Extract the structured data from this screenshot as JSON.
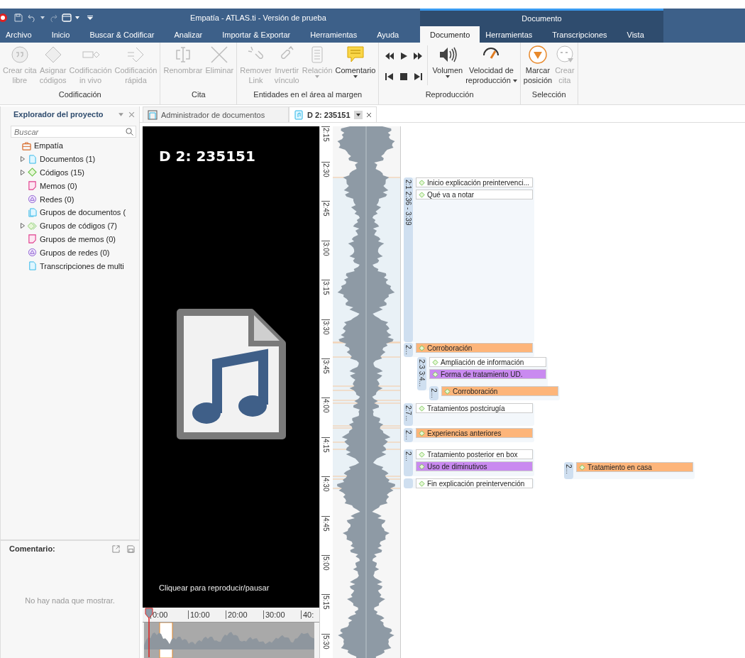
{
  "window": {
    "title": "Empatía - ATLAS.ti - Versión de prueba",
    "context_title": "Documento"
  },
  "menu_tabs": [
    {
      "label": "Archivo",
      "selected": false
    },
    {
      "label": "Inicio",
      "selected": false
    },
    {
      "label": "Buscar & Codificar",
      "selected": false
    },
    {
      "label": "Analizar",
      "selected": false
    },
    {
      "label": "Importar & Exportar",
      "selected": false
    },
    {
      "label": "Herramientas",
      "selected": false
    },
    {
      "label": "Ayuda",
      "selected": false
    }
  ],
  "context_tabs": [
    {
      "label": "Documento",
      "selected": true
    },
    {
      "label": "Herramientas",
      "selected": false
    },
    {
      "label": "Transcripciones",
      "selected": false
    },
    {
      "label": "Vista",
      "selected": false
    }
  ],
  "ribbon": [
    {
      "title": "Codificación",
      "buttons": [
        {
          "kind": "quote",
          "label": "Crear cita\nlibre",
          "disabled": true,
          "dropdown": false
        },
        {
          "kind": "diamond",
          "label": "Asignar\ncódigos",
          "disabled": true,
          "dropdown": false
        },
        {
          "kind": "invivo",
          "label": "Codificación\nin vivo",
          "disabled": true,
          "dropdown": false
        },
        {
          "kind": "quickcode",
          "label": "Codificación\nrápida",
          "disabled": true,
          "dropdown": false
        }
      ]
    },
    {
      "title": "Cita",
      "buttons": [
        {
          "kind": "rename",
          "label": "Renombrar",
          "disabled": true,
          "dropdown": false
        },
        {
          "kind": "delete",
          "label": "Eliminar",
          "disabled": true,
          "dropdown": false
        }
      ]
    },
    {
      "title": "Entidades en el área al margen",
      "buttons": [
        {
          "kind": "unlink",
          "label": "Remover\nLink",
          "disabled": true,
          "dropdown": false
        },
        {
          "kind": "invert",
          "label": "Invertir\nvínculo",
          "disabled": true,
          "dropdown": false
        },
        {
          "kind": "relation",
          "label": "Relación",
          "disabled": true,
          "dropdown": true
        },
        {
          "kind": "comment",
          "label": "Comentario",
          "disabled": false,
          "dropdown": true
        }
      ]
    },
    {
      "title": "Reproducción",
      "buttons": [
        {
          "kind": "rewind"
        },
        {
          "kind": "play"
        },
        {
          "kind": "forward"
        },
        {
          "kind": "start"
        },
        {
          "kind": "stop"
        },
        {
          "kind": "end"
        },
        {
          "kind": "volume",
          "label": "Volumen",
          "disabled": false,
          "dropdown": true
        },
        {
          "kind": "speed",
          "label": "Velocidad de\nreproducción",
          "disabled": false,
          "dropdown": true
        }
      ]
    },
    {
      "title": "Selección",
      "buttons": [
        {
          "kind": "mark",
          "label": "Marcar\nposición",
          "disabled": false,
          "dropdown": false
        },
        {
          "kind": "quote2",
          "label": "Crear\ncita",
          "disabled": true,
          "dropdown": false
        }
      ]
    }
  ],
  "explorer": {
    "title": "Explorador del proyecto",
    "search_placeholder": "Buscar",
    "tree": [
      {
        "label": "Empatía",
        "kind": "project",
        "expandable": false,
        "children": [
          {
            "label": "Documentos (1)",
            "kind": "document",
            "expandable": true
          },
          {
            "label": "Códigos (15)",
            "kind": "code",
            "expandable": true
          },
          {
            "label": "Memos (0)",
            "kind": "memo",
            "expandable": false
          },
          {
            "label": "Redes (0)",
            "kind": "network",
            "expandable": false
          },
          {
            "label": "Grupos de documentos (",
            "kind": "docgroup",
            "expandable": false
          },
          {
            "label": "Grupos de códigos (7)",
            "kind": "codegroup",
            "expandable": true
          },
          {
            "label": "Grupos de memos (0)",
            "kind": "memogroup",
            "expandable": false
          },
          {
            "label": "Grupos de redes (0)",
            "kind": "netgroup",
            "expandable": false
          },
          {
            "label": "Transcripciones de multi",
            "kind": "transcription",
            "expandable": false
          }
        ]
      }
    ]
  },
  "comment": {
    "title": "Comentario:",
    "empty_text": "No hay nada que mostrar."
  },
  "doc_tabs": [
    {
      "label": "Administrador de documentos",
      "selected": false
    },
    {
      "label": "D 2: 235151",
      "selected": true
    }
  ],
  "media": {
    "title": "D 2: 235151",
    "hint": "Cliquear para reproducir/pausar",
    "overview_ticks": [
      "0:00",
      "10:00",
      "20:00",
      "30:00",
      "40:"
    ]
  },
  "ruler_ticks": [
    "2:15",
    "2:30",
    "2:45",
    "3:00",
    "3:15",
    "3:30",
    "3:45",
    "4:00",
    "4:15",
    "4:30",
    "4:45",
    "5:00",
    "5:15",
    "5:30"
  ],
  "quotes": [
    {
      "label": "2:1 2:36 - 3:39",
      "codes": [
        {
          "name": "Inicio explicación preintervenci...",
          "color": "#ffffff"
        },
        {
          "name": "Qué va a notar",
          "color": "#ffffff"
        }
      ]
    },
    {
      "label": "2...",
      "codes": [
        {
          "name": "Corroboración",
          "color": "#fdb57a"
        }
      ]
    },
    {
      "label": "2:3 3:4...",
      "codes": [
        {
          "name": "Ampliación de información",
          "color": "#ffffff"
        },
        {
          "name": "Forma de tratamiento UD.",
          "color": "#c98af0"
        }
      ]
    },
    {
      "label": "2...",
      "codes": [
        {
          "name": "Corroboración",
          "color": "#fdb57a"
        }
      ]
    },
    {
      "label": "2:7...",
      "codes": [
        {
          "name": "Tratamientos postcirugía",
          "color": "#ffffff"
        }
      ]
    },
    {
      "label": "2...",
      "codes": [
        {
          "name": "Experiencias anteriores",
          "color": "#fdb57a"
        }
      ]
    },
    {
      "label": "2...",
      "codes": [
        {
          "name": "Tratamiento posterior en box",
          "color": "#ffffff"
        },
        {
          "name": "Uso de diminutivos",
          "color": "#c98af0"
        }
      ]
    },
    {
      "label": "2...",
      "codes": [
        {
          "name": "Tratamiento en casa",
          "color": "#fdb57a"
        }
      ]
    },
    {
      "codes": [
        {
          "name": "Fin explicación preintervención",
          "color": "#ffffff"
        }
      ]
    }
  ]
}
